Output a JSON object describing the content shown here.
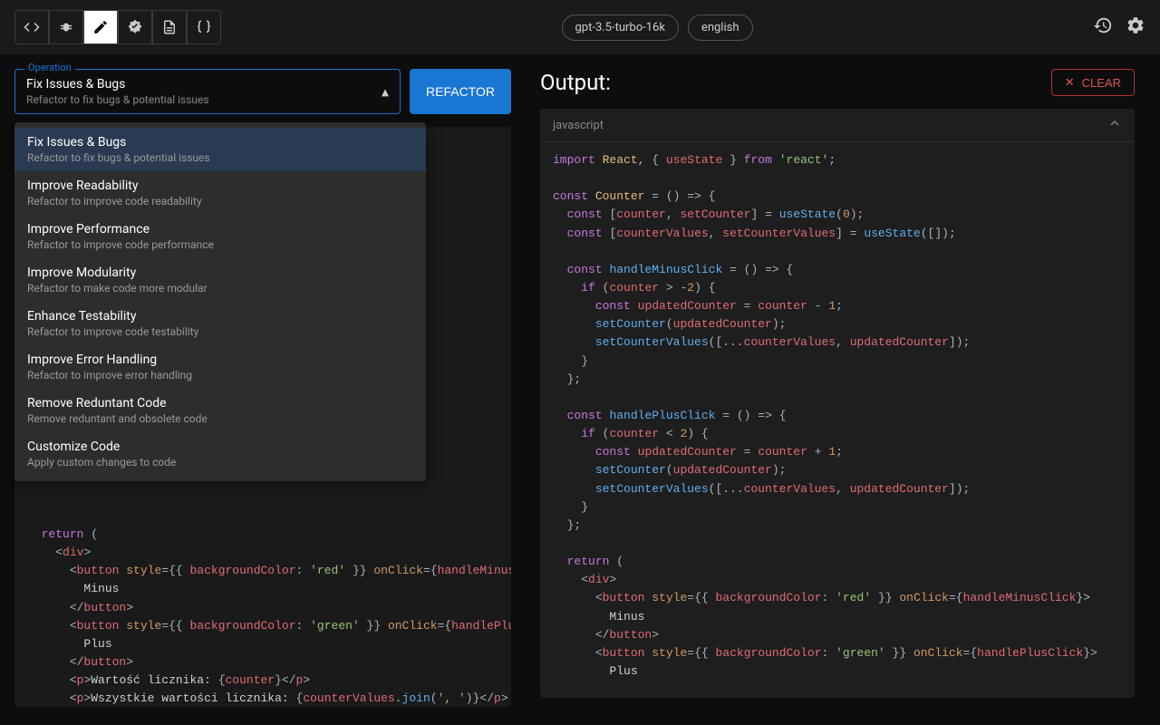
{
  "topbar": {
    "pills": [
      "gpt-3.5-turbo-16k",
      "english"
    ]
  },
  "operation": {
    "label": "Operation",
    "selected_title": "Fix Issues & Bugs",
    "selected_sub": "Refactor to fix bugs & potential issues",
    "button": "REFACTOR"
  },
  "dropdown": [
    {
      "title": "Fix Issues & Bugs",
      "sub": "Refactor to fix bugs & potential issues",
      "selected": true
    },
    {
      "title": "Improve Readability",
      "sub": "Refactor to improve code readability"
    },
    {
      "title": "Improve Performance",
      "sub": "Refactor to improve code performance"
    },
    {
      "title": "Improve Modularity",
      "sub": "Refactor to make code more modular"
    },
    {
      "title": "Enhance Testability",
      "sub": "Refactor to improve code testability"
    },
    {
      "title": "Improve Error Handling",
      "sub": "Refactor to improve error handling"
    },
    {
      "title": "Remove Reduntant Code",
      "sub": "Remove reduntant and obsolete code"
    },
    {
      "title": "Customize Code",
      "sub": "Apply custom changes to code"
    }
  ],
  "output": {
    "title": "Output:",
    "clear": "CLEAR",
    "lang": "javascript"
  },
  "left_code_html": "  <span class='k-keyword'>return</span> <span class='k-punc'>(</span>\n    <span class='k-punc'>&lt;</span><span class='k-tag'>div</span><span class='k-punc'>&gt;</span>\n      <span class='k-punc'>&lt;</span><span class='k-tag'>button</span> <span class='k-attr'>style</span><span class='k-punc'>={{ </span><span class='k-prop'>backgroundColor</span><span class='k-punc'>: </span><span class='k-str'>'red'</span><span class='k-punc'> }} </span><span class='k-attr'>onClick</span><span class='k-punc'>={</span><span class='k-var'>handleMinusC</span>\n        <span class='k-text'>Minus</span>\n      <span class='k-punc'>&lt;/</span><span class='k-tag'>button</span><span class='k-punc'>&gt;</span>\n      <span class='k-punc'>&lt;</span><span class='k-tag'>button</span> <span class='k-attr'>style</span><span class='k-punc'>={{ </span><span class='k-prop'>backgroundColor</span><span class='k-punc'>: </span><span class='k-str'>'green'</span><span class='k-punc'> }} </span><span class='k-attr'>onClick</span><span class='k-punc'>={</span><span class='k-var'>handlePlus</span>\n        <span class='k-text'>Plus</span>\n      <span class='k-punc'>&lt;/</span><span class='k-tag'>button</span><span class='k-punc'>&gt;</span>\n      <span class='k-punc'>&lt;</span><span class='k-tag'>p</span><span class='k-punc'>&gt;</span><span class='k-text'>Wartość licznika: </span><span class='k-punc'>{</span><span class='k-var'>counter</span><span class='k-punc'>}&lt;/</span><span class='k-tag'>p</span><span class='k-punc'>&gt;</span>\n      <span class='k-punc'>&lt;</span><span class='k-tag'>p</span><span class='k-punc'>&gt;</span><span class='k-text'>Wszystkie wartości licznika: </span><span class='k-punc'>{</span><span class='k-var'>counterValues</span><span class='k-punc'>.</span><span class='k-fn'>join</span><span class='k-punc'>(</span><span class='k-str'>', '</span><span class='k-punc'>)}&lt;/</span><span class='k-tag'>p</span><span class='k-punc'>&gt;</span>",
  "right_code_html": "<span class='k-import'>import</span> <span class='k-name'>React</span><span class='k-punc'>, { </span><span class='k-var'>useState</span><span class='k-punc'> } </span><span class='k-import'>from</span> <span class='k-str'>'react'</span><span class='k-punc'>;</span>\n\n<span class='k-const'>const</span> <span class='k-name'>Counter</span> <span class='k-punc'>= () =&gt; {</span>\n  <span class='k-const'>const</span> <span class='k-punc'>[</span><span class='k-var'>counter</span><span class='k-punc'>, </span><span class='k-var'>setCounter</span><span class='k-punc'>] = </span><span class='k-fn'>useState</span><span class='k-punc'>(</span><span class='k-num'>0</span><span class='k-punc'>);</span>\n  <span class='k-const'>const</span> <span class='k-punc'>[</span><span class='k-var'>counterValues</span><span class='k-punc'>, </span><span class='k-var'>setCounterValues</span><span class='k-punc'>] = </span><span class='k-fn'>useState</span><span class='k-punc'>([]);</span>\n\n  <span class='k-const'>const</span> <span class='k-fn'>handleMinusClick</span> <span class='k-punc'>= () =&gt; {</span>\n    <span class='k-keyword'>if</span> <span class='k-punc'>(</span><span class='k-var'>counter</span> <span class='k-punc'>&gt; -</span><span class='k-num'>2</span><span class='k-punc'>) {</span>\n      <span class='k-const'>const</span> <span class='k-var'>updatedCounter</span> <span class='k-punc'>= </span><span class='k-var'>counter</span> <span class='k-punc'>- </span><span class='k-num'>1</span><span class='k-punc'>;</span>\n      <span class='k-fn'>setCounter</span><span class='k-punc'>(</span><span class='k-var'>updatedCounter</span><span class='k-punc'>);</span>\n      <span class='k-fn'>setCounterValues</span><span class='k-punc'>([...</span><span class='k-var'>counterValues</span><span class='k-punc'>, </span><span class='k-var'>updatedCounter</span><span class='k-punc'>]);</span>\n    <span class='k-punc'>}</span>\n  <span class='k-punc'>};</span>\n\n  <span class='k-const'>const</span> <span class='k-fn'>handlePlusClick</span> <span class='k-punc'>= () =&gt; {</span>\n    <span class='k-keyword'>if</span> <span class='k-punc'>(</span><span class='k-var'>counter</span> <span class='k-punc'>&lt; </span><span class='k-num'>2</span><span class='k-punc'>) {</span>\n      <span class='k-const'>const</span> <span class='k-var'>updatedCounter</span> <span class='k-punc'>= </span><span class='k-var'>counter</span> <span class='k-punc'>+ </span><span class='k-num'>1</span><span class='k-punc'>;</span>\n      <span class='k-fn'>setCounter</span><span class='k-punc'>(</span><span class='k-var'>updatedCounter</span><span class='k-punc'>);</span>\n      <span class='k-fn'>setCounterValues</span><span class='k-punc'>([...</span><span class='k-var'>counterValues</span><span class='k-punc'>, </span><span class='k-var'>updatedCounter</span><span class='k-punc'>]);</span>\n    <span class='k-punc'>}</span>\n  <span class='k-punc'>};</span>\n\n  <span class='k-keyword'>return</span> <span class='k-punc'>(</span>\n    <span class='k-punc'>&lt;</span><span class='k-tag'>div</span><span class='k-punc'>&gt;</span>\n      <span class='k-punc'>&lt;</span><span class='k-tag'>button</span> <span class='k-attr'>style</span><span class='k-punc'>={{ </span><span class='k-prop'>backgroundColor</span><span class='k-punc'>: </span><span class='k-str'>'red'</span><span class='k-punc'> }} </span><span class='k-attr'>onClick</span><span class='k-punc'>={</span><span class='k-var'>handleMinusClick</span><span class='k-punc'>}&gt;</span>\n        <span class='k-text'>Minus</span>\n      <span class='k-punc'>&lt;/</span><span class='k-tag'>button</span><span class='k-punc'>&gt;</span>\n      <span class='k-punc'>&lt;</span><span class='k-tag'>button</span> <span class='k-attr'>style</span><span class='k-punc'>={{ </span><span class='k-prop'>backgroundColor</span><span class='k-punc'>: </span><span class='k-str'>'green'</span><span class='k-punc'> }} </span><span class='k-attr'>onClick</span><span class='k-punc'>={</span><span class='k-var'>handlePlusClick</span><span class='k-punc'>}&gt;</span>\n        <span class='k-text'>Plus</span>"
}
